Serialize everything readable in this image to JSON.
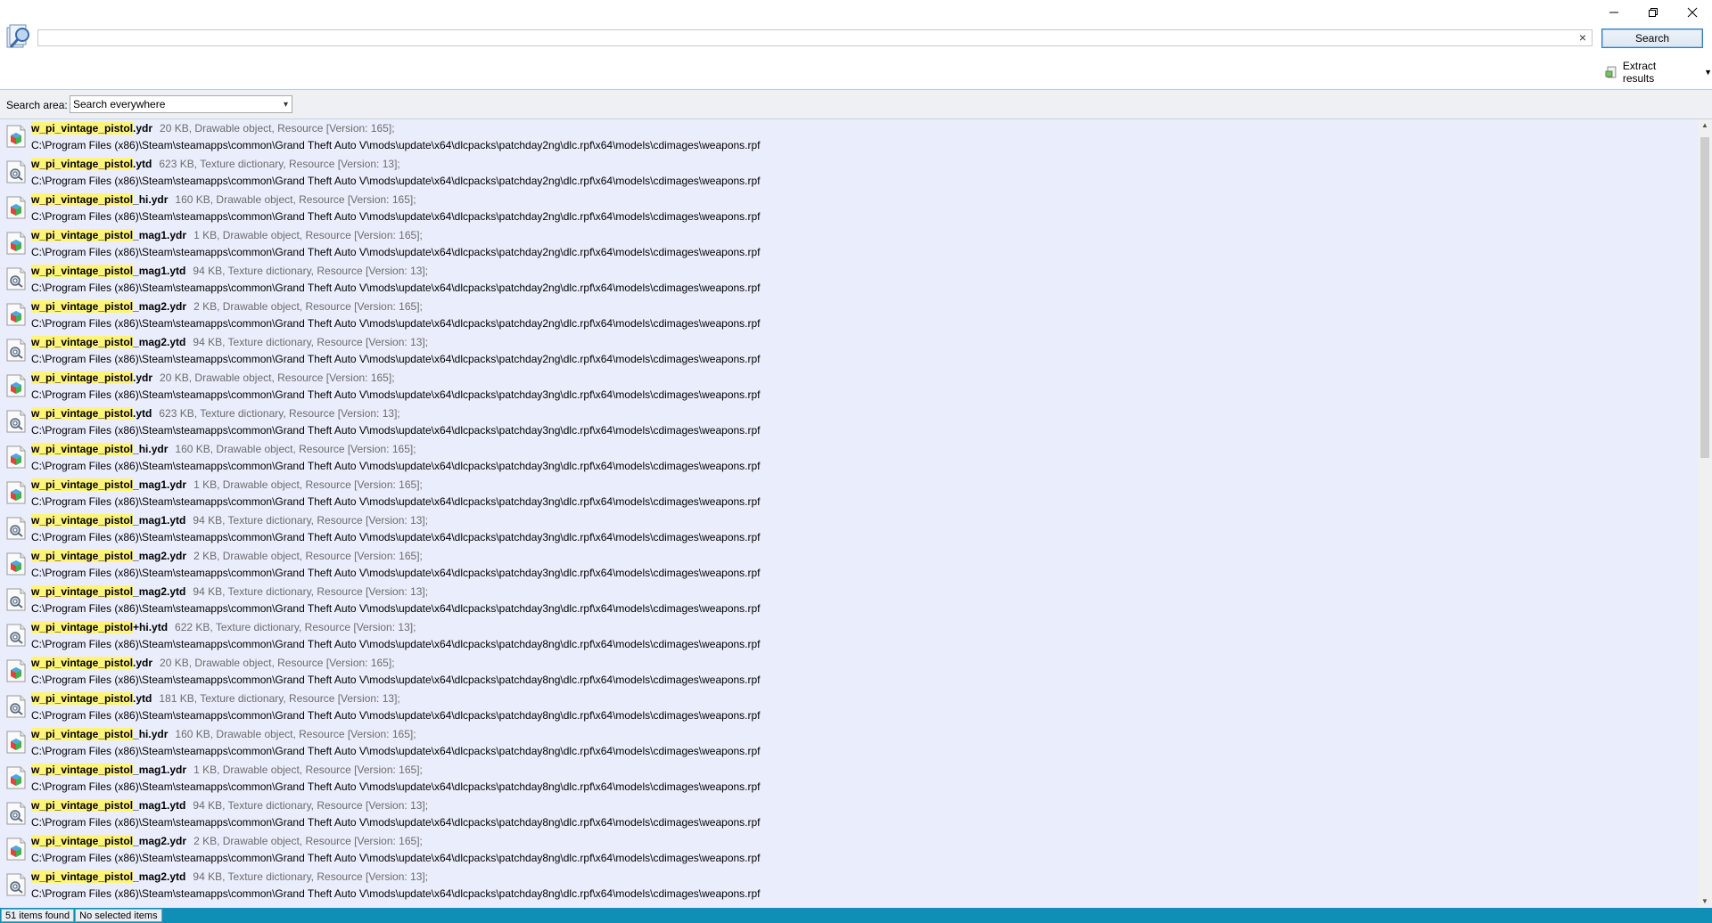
{
  "window": {
    "minimize_icon": "minimize-icon",
    "restore_icon": "restore-icon",
    "close_icon": "close-icon"
  },
  "search": {
    "value": "",
    "clear_glyph": "×",
    "button_label": "Search"
  },
  "toolbar": {
    "extract_label": "Extract results"
  },
  "area": {
    "label": "Search area:",
    "selected": "Search everywhere"
  },
  "results": [
    {
      "hl": "w_pi_vintage_pistol",
      "rest": ".ydr",
      "meta": "20 KB, Drawable object, Resource [Version: 165];",
      "path": "C:\\Program Files (x86)\\Steam\\steamapps\\common\\Grand Theft Auto V\\mods\\update\\x64\\dlcpacks\\patchday2ng\\dlc.rpf\\x64\\models\\cdimages\\weapons.rpf",
      "icon": "drawable"
    },
    {
      "hl": "w_pi_vintage_pistol",
      "rest": ".ytd",
      "meta": "623 KB, Texture dictionary, Resource [Version: 13];",
      "path": "C:\\Program Files (x86)\\Steam\\steamapps\\common\\Grand Theft Auto V\\mods\\update\\x64\\dlcpacks\\patchday2ng\\dlc.rpf\\x64\\models\\cdimages\\weapons.rpf",
      "icon": "texture"
    },
    {
      "hl": "w_pi_vintage_pistol",
      "rest": "_hi.ydr",
      "meta": "160 KB, Drawable object, Resource [Version: 165];",
      "path": "C:\\Program Files (x86)\\Steam\\steamapps\\common\\Grand Theft Auto V\\mods\\update\\x64\\dlcpacks\\patchday2ng\\dlc.rpf\\x64\\models\\cdimages\\weapons.rpf",
      "icon": "drawable"
    },
    {
      "hl": "w_pi_vintage_pistol",
      "rest": "_mag1.ydr",
      "meta": "1 KB, Drawable object, Resource [Version: 165];",
      "path": "C:\\Program Files (x86)\\Steam\\steamapps\\common\\Grand Theft Auto V\\mods\\update\\x64\\dlcpacks\\patchday2ng\\dlc.rpf\\x64\\models\\cdimages\\weapons.rpf",
      "icon": "drawable"
    },
    {
      "hl": "w_pi_vintage_pistol",
      "rest": "_mag1.ytd",
      "meta": "94 KB, Texture dictionary, Resource [Version: 13];",
      "path": "C:\\Program Files (x86)\\Steam\\steamapps\\common\\Grand Theft Auto V\\mods\\update\\x64\\dlcpacks\\patchday2ng\\dlc.rpf\\x64\\models\\cdimages\\weapons.rpf",
      "icon": "texture"
    },
    {
      "hl": "w_pi_vintage_pistol",
      "rest": "_mag2.ydr",
      "meta": "2 KB, Drawable object, Resource [Version: 165];",
      "path": "C:\\Program Files (x86)\\Steam\\steamapps\\common\\Grand Theft Auto V\\mods\\update\\x64\\dlcpacks\\patchday2ng\\dlc.rpf\\x64\\models\\cdimages\\weapons.rpf",
      "icon": "drawable"
    },
    {
      "hl": "w_pi_vintage_pistol",
      "rest": "_mag2.ytd",
      "meta": "94 KB, Texture dictionary, Resource [Version: 13];",
      "path": "C:\\Program Files (x86)\\Steam\\steamapps\\common\\Grand Theft Auto V\\mods\\update\\x64\\dlcpacks\\patchday2ng\\dlc.rpf\\x64\\models\\cdimages\\weapons.rpf",
      "icon": "texture"
    },
    {
      "hl": "w_pi_vintage_pistol",
      "rest": ".ydr",
      "meta": "20 KB, Drawable object, Resource [Version: 165];",
      "path": "C:\\Program Files (x86)\\Steam\\steamapps\\common\\Grand Theft Auto V\\mods\\update\\x64\\dlcpacks\\patchday3ng\\dlc.rpf\\x64\\models\\cdimages\\weapons.rpf",
      "icon": "drawable"
    },
    {
      "hl": "w_pi_vintage_pistol",
      "rest": ".ytd",
      "meta": "623 KB, Texture dictionary, Resource [Version: 13];",
      "path": "C:\\Program Files (x86)\\Steam\\steamapps\\common\\Grand Theft Auto V\\mods\\update\\x64\\dlcpacks\\patchday3ng\\dlc.rpf\\x64\\models\\cdimages\\weapons.rpf",
      "icon": "texture"
    },
    {
      "hl": "w_pi_vintage_pistol",
      "rest": "_hi.ydr",
      "meta": "160 KB, Drawable object, Resource [Version: 165];",
      "path": "C:\\Program Files (x86)\\Steam\\steamapps\\common\\Grand Theft Auto V\\mods\\update\\x64\\dlcpacks\\patchday3ng\\dlc.rpf\\x64\\models\\cdimages\\weapons.rpf",
      "icon": "drawable"
    },
    {
      "hl": "w_pi_vintage_pistol",
      "rest": "_mag1.ydr",
      "meta": "1 KB, Drawable object, Resource [Version: 165];",
      "path": "C:\\Program Files (x86)\\Steam\\steamapps\\common\\Grand Theft Auto V\\mods\\update\\x64\\dlcpacks\\patchday3ng\\dlc.rpf\\x64\\models\\cdimages\\weapons.rpf",
      "icon": "drawable"
    },
    {
      "hl": "w_pi_vintage_pistol",
      "rest": "_mag1.ytd",
      "meta": "94 KB, Texture dictionary, Resource [Version: 13];",
      "path": "C:\\Program Files (x86)\\Steam\\steamapps\\common\\Grand Theft Auto V\\mods\\update\\x64\\dlcpacks\\patchday3ng\\dlc.rpf\\x64\\models\\cdimages\\weapons.rpf",
      "icon": "texture"
    },
    {
      "hl": "w_pi_vintage_pistol",
      "rest": "_mag2.ydr",
      "meta": "2 KB, Drawable object, Resource [Version: 165];",
      "path": "C:\\Program Files (x86)\\Steam\\steamapps\\common\\Grand Theft Auto V\\mods\\update\\x64\\dlcpacks\\patchday3ng\\dlc.rpf\\x64\\models\\cdimages\\weapons.rpf",
      "icon": "drawable"
    },
    {
      "hl": "w_pi_vintage_pistol",
      "rest": "_mag2.ytd",
      "meta": "94 KB, Texture dictionary, Resource [Version: 13];",
      "path": "C:\\Program Files (x86)\\Steam\\steamapps\\common\\Grand Theft Auto V\\mods\\update\\x64\\dlcpacks\\patchday3ng\\dlc.rpf\\x64\\models\\cdimages\\weapons.rpf",
      "icon": "texture"
    },
    {
      "hl": "w_pi_vintage_pistol",
      "rest": "+hi.ytd",
      "meta": "622 KB, Texture dictionary, Resource [Version: 13];",
      "path": "C:\\Program Files (x86)\\Steam\\steamapps\\common\\Grand Theft Auto V\\mods\\update\\x64\\dlcpacks\\patchday8ng\\dlc.rpf\\x64\\models\\cdimages\\weapons.rpf",
      "icon": "texture"
    },
    {
      "hl": "w_pi_vintage_pistol",
      "rest": ".ydr",
      "meta": "20 KB, Drawable object, Resource [Version: 165];",
      "path": "C:\\Program Files (x86)\\Steam\\steamapps\\common\\Grand Theft Auto V\\mods\\update\\x64\\dlcpacks\\patchday8ng\\dlc.rpf\\x64\\models\\cdimages\\weapons.rpf",
      "icon": "drawable"
    },
    {
      "hl": "w_pi_vintage_pistol",
      "rest": ".ytd",
      "meta": "181 KB, Texture dictionary, Resource [Version: 13];",
      "path": "C:\\Program Files (x86)\\Steam\\steamapps\\common\\Grand Theft Auto V\\mods\\update\\x64\\dlcpacks\\patchday8ng\\dlc.rpf\\x64\\models\\cdimages\\weapons.rpf",
      "icon": "texture"
    },
    {
      "hl": "w_pi_vintage_pistol",
      "rest": "_hi.ydr",
      "meta": "160 KB, Drawable object, Resource [Version: 165];",
      "path": "C:\\Program Files (x86)\\Steam\\steamapps\\common\\Grand Theft Auto V\\mods\\update\\x64\\dlcpacks\\patchday8ng\\dlc.rpf\\x64\\models\\cdimages\\weapons.rpf",
      "icon": "drawable"
    },
    {
      "hl": "w_pi_vintage_pistol",
      "rest": "_mag1.ydr",
      "meta": "1 KB, Drawable object, Resource [Version: 165];",
      "path": "C:\\Program Files (x86)\\Steam\\steamapps\\common\\Grand Theft Auto V\\mods\\update\\x64\\dlcpacks\\patchday8ng\\dlc.rpf\\x64\\models\\cdimages\\weapons.rpf",
      "icon": "drawable"
    },
    {
      "hl": "w_pi_vintage_pistol",
      "rest": "_mag1.ytd",
      "meta": "94 KB, Texture dictionary, Resource [Version: 13];",
      "path": "C:\\Program Files (x86)\\Steam\\steamapps\\common\\Grand Theft Auto V\\mods\\update\\x64\\dlcpacks\\patchday8ng\\dlc.rpf\\x64\\models\\cdimages\\weapons.rpf",
      "icon": "texture"
    },
    {
      "hl": "w_pi_vintage_pistol",
      "rest": "_mag2.ydr",
      "meta": "2 KB, Drawable object, Resource [Version: 165];",
      "path": "C:\\Program Files (x86)\\Steam\\steamapps\\common\\Grand Theft Auto V\\mods\\update\\x64\\dlcpacks\\patchday8ng\\dlc.rpf\\x64\\models\\cdimages\\weapons.rpf",
      "icon": "drawable"
    },
    {
      "hl": "w_pi_vintage_pistol",
      "rest": "_mag2.ytd",
      "meta": "94 KB, Texture dictionary, Resource [Version: 13];",
      "path": "C:\\Program Files (x86)\\Steam\\steamapps\\common\\Grand Theft Auto V\\mods\\update\\x64\\dlcpacks\\patchday8ng\\dlc.rpf\\x64\\models\\cdimages\\weapons.rpf",
      "icon": "texture"
    }
  ],
  "status": {
    "found": "51 items found",
    "selected": "No selected items"
  },
  "colors": {
    "highlight": "#fff47a",
    "list_bg": "#eaedfb",
    "status_bar": "#0f8fb5"
  }
}
